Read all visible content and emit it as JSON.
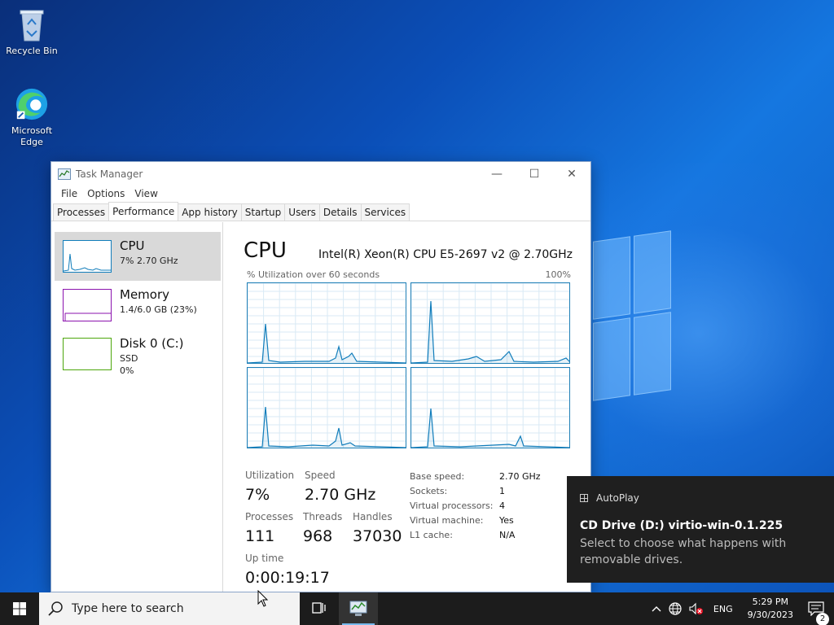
{
  "desktop": {
    "icons": [
      {
        "label": "Recycle Bin",
        "icon": "recycle-bin-icon"
      },
      {
        "label": "Microsoft\nEdge",
        "icon": "edge-icon"
      }
    ]
  },
  "window": {
    "title": "Task Manager",
    "menu": [
      "File",
      "Options",
      "View"
    ],
    "tabs": [
      "Processes",
      "Performance",
      "App history",
      "Startup",
      "Users",
      "Details",
      "Services"
    ],
    "active_tab": "Performance"
  },
  "sidebar": {
    "items": [
      {
        "name": "CPU",
        "sub1": "7%  2.70 GHz",
        "sub2": "",
        "color": "#117dbb"
      },
      {
        "name": "Memory",
        "sub1": "1.4/6.0 GB (23%)",
        "sub2": "",
        "color": "#8b12ae"
      },
      {
        "name": "Disk 0 (C:)",
        "sub1": "SSD",
        "sub2": "0%",
        "color": "#4da60c"
      }
    ]
  },
  "cpu": {
    "title": "CPU",
    "model": "Intel(R) Xeon(R) CPU E5-2697 v2 @ 2.70GHz",
    "graph_label": "% Utilization over 60 seconds",
    "graph_max": "100%",
    "stats": {
      "utilization_label": "Utilization",
      "utilization": "7%",
      "speed_label": "Speed",
      "speed": "2.70 GHz",
      "processes_label": "Processes",
      "processes": "111",
      "threads_label": "Threads",
      "threads": "968",
      "handles_label": "Handles",
      "handles": "37030",
      "uptime_label": "Up time",
      "uptime": "0:00:19:17"
    },
    "details": [
      {
        "k": "Base speed:",
        "v": "2.70 GHz"
      },
      {
        "k": "Sockets:",
        "v": "1"
      },
      {
        "k": "Virtual processors:",
        "v": "4"
      },
      {
        "k": "Virtual machine:",
        "v": "Yes"
      },
      {
        "k": "L1 cache:",
        "v": "N/A"
      }
    ]
  },
  "toast": {
    "app": "AutoPlay",
    "title": "CD Drive (D:) virtio-win-0.1.225",
    "body": "Select to choose what happens with removable drives."
  },
  "taskbar": {
    "search_placeholder": "Type here to search",
    "lang": "ENG",
    "time": "5:29 PM",
    "date": "9/30/2023",
    "notifications": "2"
  }
}
